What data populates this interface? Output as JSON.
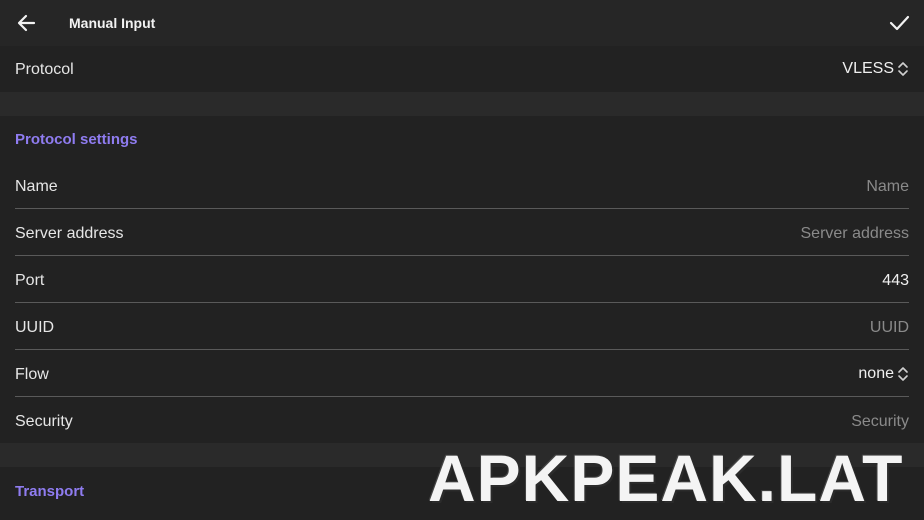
{
  "header": {
    "title": "Manual Input"
  },
  "protocol": {
    "label": "Protocol",
    "value": "VLESS"
  },
  "sections": {
    "protocol_settings": "Protocol settings",
    "transport": "Transport"
  },
  "fields": {
    "name": {
      "label": "Name",
      "placeholder": "Name"
    },
    "server": {
      "label": "Server address",
      "placeholder": "Server address"
    },
    "port": {
      "label": "Port",
      "value": "443"
    },
    "uuid": {
      "label": "UUID",
      "placeholder": "UUID"
    },
    "flow": {
      "label": "Flow",
      "value": "none"
    },
    "security": {
      "label": "Security",
      "placeholder": "Security"
    }
  },
  "watermark": "APKPEAK.LAT",
  "colors": {
    "accent": "#8f7cf0",
    "background": "#1e1e1e"
  },
  "icons": {
    "back": "arrow-left-icon",
    "confirm": "check-icon",
    "select": "chevron-updown-icon"
  }
}
